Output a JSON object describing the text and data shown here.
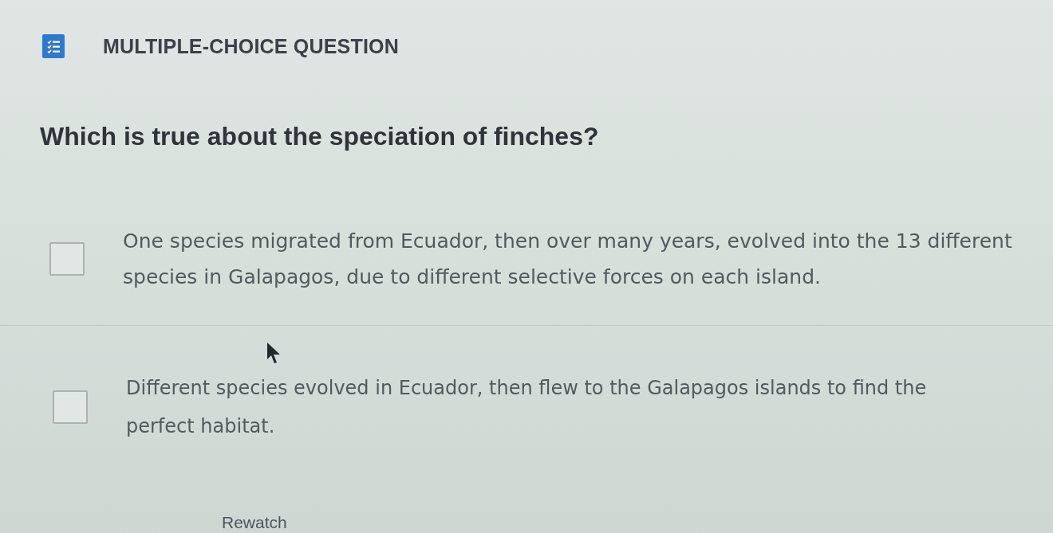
{
  "header": {
    "title": "MULTIPLE-CHOICE QUESTION"
  },
  "question": "Which is true about the speciation of finches?",
  "options": [
    {
      "text": "One species migrated from Ecuador, then over many years, evolved into the 13 different species in Galapagos, due to different selective forces on each island.",
      "checked": false
    },
    {
      "text": "Different species evolved in Ecuador, then flew to the Galapagos islands to find the perfect habitat.",
      "checked": false
    }
  ],
  "footer": {
    "link": "Rewatch"
  }
}
